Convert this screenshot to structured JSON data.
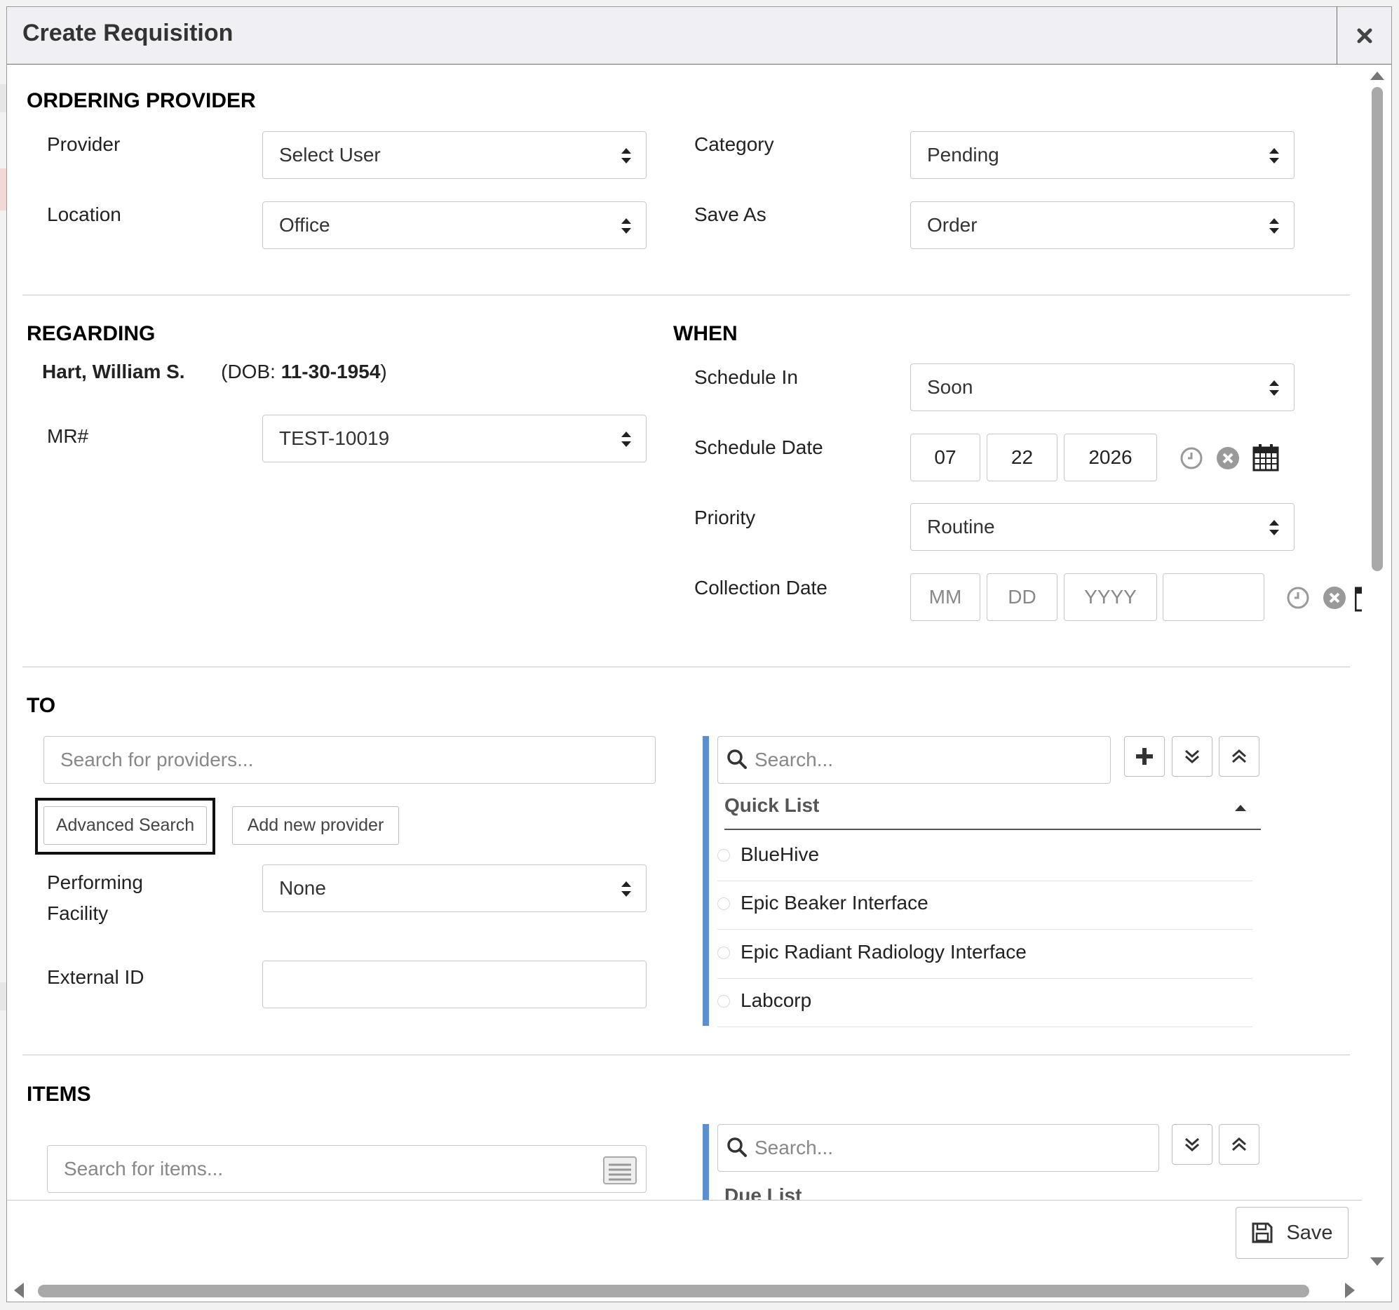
{
  "dialog": {
    "title": "Create Requisition"
  },
  "ordering_provider": {
    "heading": "ORDERING PROVIDER",
    "provider_label": "Provider",
    "provider_value": "Select User",
    "location_label": "Location",
    "location_value": "Office",
    "category_label": "Category",
    "category_value": "Pending",
    "save_as_label": "Save As",
    "save_as_value": "Order"
  },
  "regarding": {
    "heading": "REGARDING",
    "patient_name": "Hart, William S.",
    "dob_prefix": "(DOB: ",
    "dob": "11-30-1954",
    "dob_suffix": ")",
    "mr_label": "MR#",
    "mr_value": "TEST-10019"
  },
  "when": {
    "heading": "WHEN",
    "schedule_in_label": "Schedule In",
    "schedule_in_value": "Soon",
    "schedule_date_label": "Schedule Date",
    "schedule_month": "07",
    "schedule_day": "22",
    "schedule_year": "2026",
    "priority_label": "Priority",
    "priority_value": "Routine",
    "collection_date_label": "Collection Date",
    "collection_mm_ph": "MM",
    "collection_dd_ph": "DD",
    "collection_yyyy_ph": "YYYY"
  },
  "to": {
    "heading": "TO",
    "provider_search_placeholder": "Search for providers...",
    "advanced_search_label": "Advanced Search",
    "add_new_provider_label": "Add new provider",
    "performing_facility_label_1": "Performing",
    "performing_facility_label_2": "Facility",
    "performing_facility_value": "None",
    "external_id_label": "External ID",
    "quick_search_placeholder": "Search...",
    "quick_list_title": "Quick List",
    "quick_list": [
      "BlueHive",
      "Epic Beaker Interface",
      "Epic Radiant Radiology Interface",
      "Labcorp"
    ]
  },
  "items": {
    "heading": "ITEMS",
    "search_placeholder": "Search for items...",
    "list_search_placeholder": "Search...",
    "due_list_title": "Due List"
  },
  "footer": {
    "save_label": "Save"
  },
  "colors": {
    "accent_bar": "#5b8fd0",
    "title_bg": "#f0f0f4",
    "scroll_thumb": "#a9a9a9"
  }
}
